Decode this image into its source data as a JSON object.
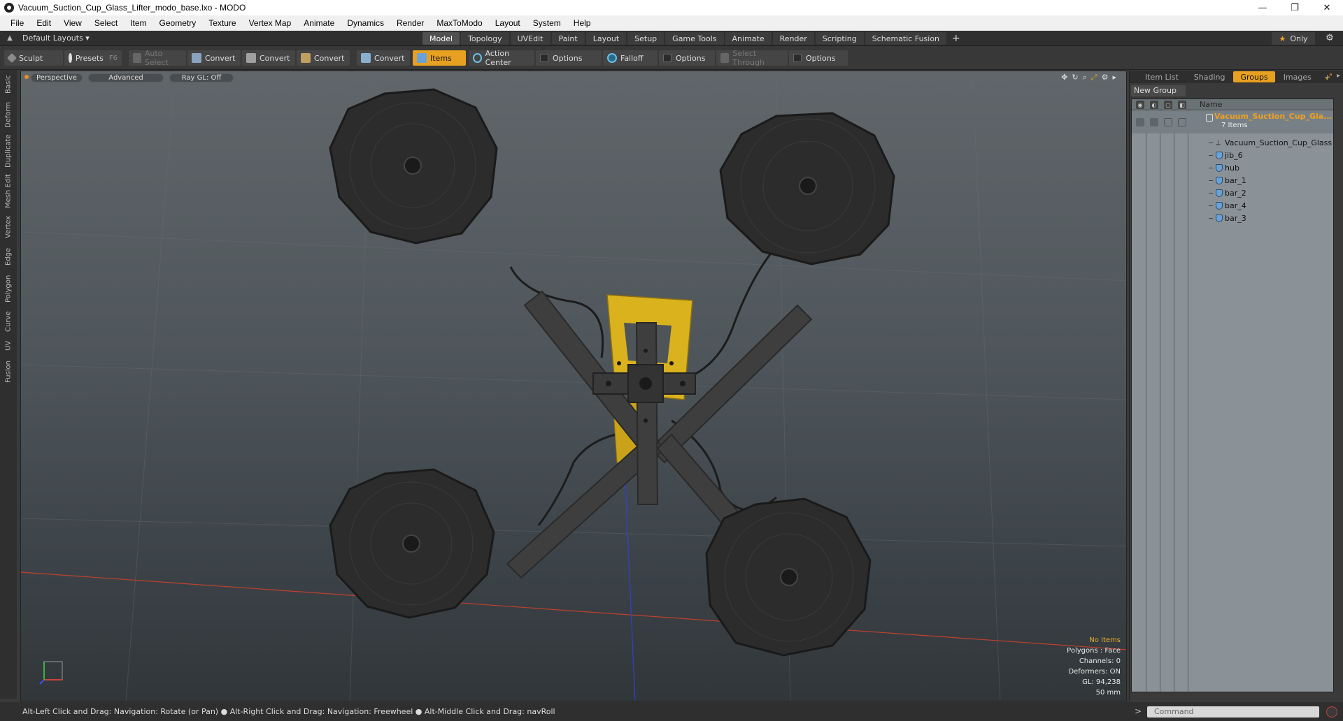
{
  "window": {
    "title": "Vacuum_Suction_Cup_Glass_Lifter_modo_base.lxo - MODO",
    "minimize": "—",
    "maximize": "❐",
    "close": "✕"
  },
  "menu": [
    "File",
    "Edit",
    "View",
    "Select",
    "Item",
    "Geometry",
    "Texture",
    "Vertex Map",
    "Animate",
    "Dynamics",
    "Render",
    "MaxToModo",
    "Layout",
    "System",
    "Help"
  ],
  "layoutbar": {
    "layout_select": "Default Layouts ▾",
    "tabs": [
      "Model",
      "Topology",
      "UVEdit",
      "Paint",
      "Layout",
      "Setup",
      "Game Tools",
      "Animate",
      "Render",
      "Scripting",
      "Schematic Fusion"
    ],
    "active_tab": "Model",
    "only_label": "Only"
  },
  "toolbar": {
    "sculpt": "Sculpt",
    "presets": "Presets",
    "presets_key": "F6",
    "auto_select": "Auto Select",
    "convert": "Convert",
    "items": "Items",
    "action_center": "Action Center",
    "options": "Options",
    "falloff": "Falloff",
    "select_through": "Select Through"
  },
  "left_tabs": [
    "Basic",
    "Deform",
    "Duplicate",
    "Mesh Edit",
    "Vertex",
    "Edge",
    "Polygon",
    "Curve",
    "UV",
    "Fusion"
  ],
  "viewport": {
    "view_mode": "Perspective",
    "shading": "Advanced",
    "raygl": "Ray GL: Off",
    "info": {
      "selection": "No Items",
      "polygons": "Polygons : Face",
      "channels": "Channels: 0",
      "deformers": "Deformers: ON",
      "gl": "GL: 94,238",
      "scale": "50 mm"
    }
  },
  "right_panel": {
    "tabs": [
      "Item List",
      "Shading",
      "Groups",
      "Images",
      "+"
    ],
    "active_tab": "Groups",
    "new_group": "New Group",
    "column_name": "Name",
    "group_title": "Vacuum_Suction_Cup_Gla...",
    "group_count": "7 Items",
    "items": [
      {
        "label": "Vacuum_Suction_Cup_Glass ...",
        "type": "locator"
      },
      {
        "label": "jib_6",
        "type": "mesh"
      },
      {
        "label": "hub",
        "type": "mesh"
      },
      {
        "label": "bar_1",
        "type": "mesh"
      },
      {
        "label": "bar_2",
        "type": "mesh"
      },
      {
        "label": "bar_4",
        "type": "mesh"
      },
      {
        "label": "bar_3",
        "type": "mesh"
      }
    ]
  },
  "status": {
    "hint": "Alt-Left Click and Drag: Navigation: Rotate (or Pan) ● Alt-Right Click and Drag: Navigation: Freewheel ● Alt-Middle Click and Drag: navRoll"
  },
  "command": {
    "placeholder": "Command",
    "prompt": ">"
  },
  "colors": {
    "accent": "#e8a020",
    "viewport_top": "#60666a",
    "viewport_bottom": "#313639",
    "hub_yellow": "#e0b820"
  }
}
